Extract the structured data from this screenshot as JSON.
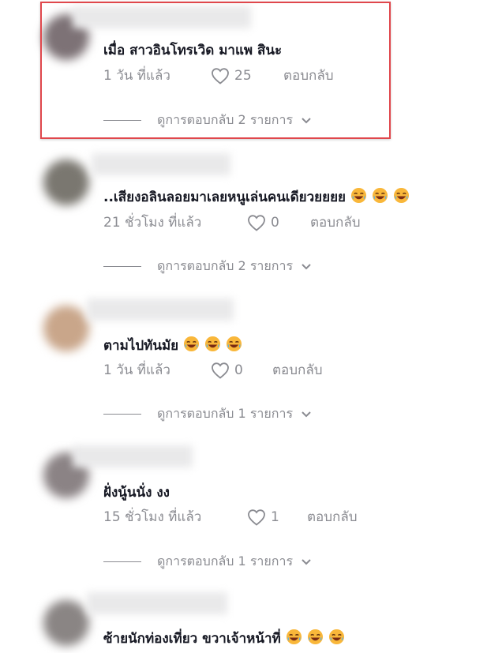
{
  "comments": [
    {
      "text": "เมื่อ สาวอินโทรเวิด มาแพ สินะ",
      "time": "1 วัน ที่แล้ว",
      "likes": "25",
      "reply": "ตอบกลับ",
      "view_replies": "ดูการตอบกลับ 2 รายการ",
      "emoji_count": 0,
      "avatar_color": "#7d7276"
    },
    {
      "text": "..เสียงอลินลอยมาเลยหนูเล่นคนเดียวยยยย",
      "time": "21 ชั่วโมง ที่แล้ว",
      "likes": "0",
      "reply": "ตอบกลับ",
      "view_replies": "ดูการตอบกลับ 2 รายการ",
      "emoji_count": 3,
      "avatar_color": "#7a7770"
    },
    {
      "text": "ตามไปทันมัย",
      "time": "1 วัน ที่แล้ว",
      "likes": "0",
      "reply": "ตอบกลับ",
      "view_replies": "ดูการตอบกลับ 1 รายการ",
      "emoji_count": 3,
      "avatar_color": "#c9a68a"
    },
    {
      "text": "ฝั่งนู้นนั่ง งง",
      "time": "15 ชั่วโมง ที่แล้ว",
      "likes": "1",
      "reply": "ตอบกลับ",
      "view_replies": "ดูการตอบกลับ 1 รายการ",
      "emoji_count": 0,
      "avatar_color": "#8b8385"
    },
    {
      "text": "ซ้ายนักท่องเที่ยว ขวาเจ้าหน้าที่",
      "emoji_count": 3,
      "avatar_color": "#8a8584"
    }
  ],
  "colors": {
    "highlight_border": "#e0474c",
    "meta_text": "#8a8b91",
    "primary_text": "#161823"
  },
  "icons": {
    "like": "heart-outline-icon",
    "expand": "chevron-down-icon",
    "emoji": "laughing-emoji"
  }
}
